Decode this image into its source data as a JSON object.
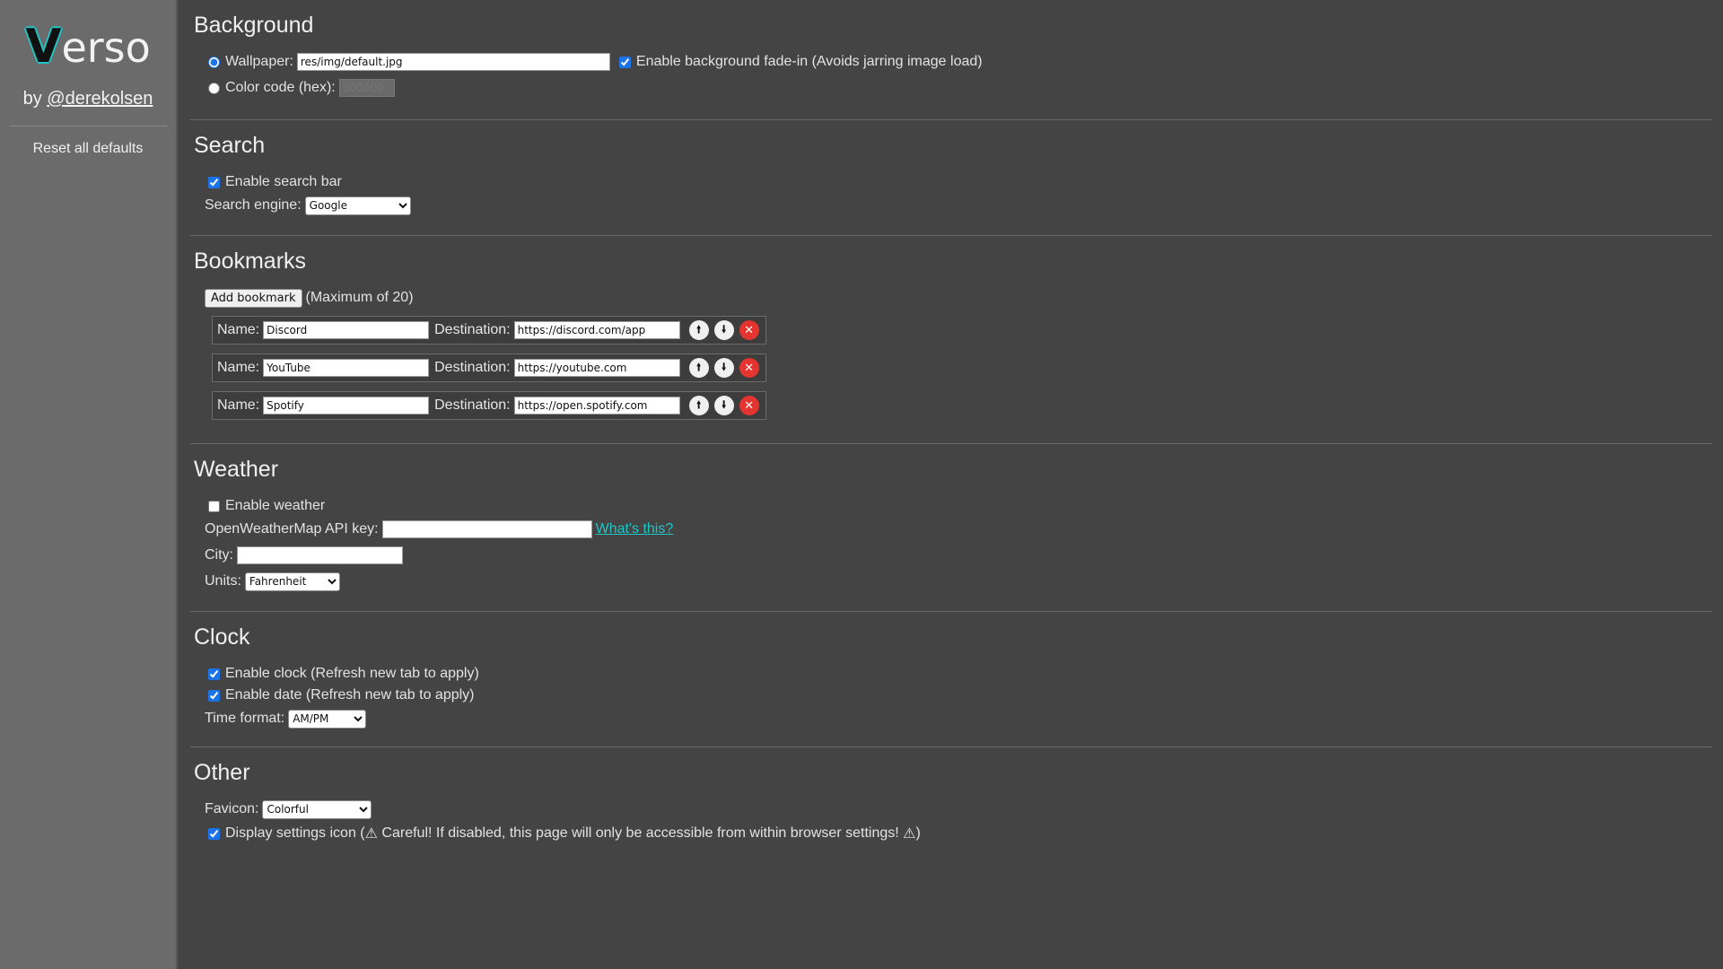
{
  "sidebar": {
    "logo_v": "V",
    "logo_rest": "erso",
    "by_prefix": "by ",
    "author_link": "@derekolsen",
    "reset_label": "Reset all defaults"
  },
  "background": {
    "title": "Background",
    "wallpaper_label": "Wallpaper:",
    "wallpaper_value": "res/img/default.jpg",
    "fadein_label": "Enable background fade-in (Avoids jarring image load)",
    "color_label": "Color code (hex):",
    "color_placeholder": "000000"
  },
  "search": {
    "title": "Search",
    "enable_label": "Enable search bar",
    "engine_label": "Search engine:",
    "engine_value": "Google"
  },
  "bookmarks": {
    "title": "Bookmarks",
    "add_label": "Add bookmark",
    "max_label": "(Maximum of 20)",
    "name_label": "Name:",
    "dest_label": "Destination:",
    "items": [
      {
        "name": "Discord",
        "dest": "https://discord.com/app"
      },
      {
        "name": "YouTube",
        "dest": "https://youtube.com"
      },
      {
        "name": "Spotify",
        "dest": "https://open.spotify.com"
      }
    ]
  },
  "weather": {
    "title": "Weather",
    "enable_label": "Enable weather",
    "api_label": "OpenWeatherMap API key:",
    "api_value": "",
    "whats_this": "What's this?",
    "city_label": "City:",
    "city_value": "",
    "units_label": "Units:",
    "units_value": "Fahrenheit"
  },
  "clock": {
    "title": "Clock",
    "clock_label": "Enable clock (Refresh new tab to apply)",
    "date_label": "Enable date (Refresh new tab to apply)",
    "format_label": "Time format:",
    "format_value": "AM/PM"
  },
  "other": {
    "title": "Other",
    "favicon_label": "Favicon:",
    "favicon_value": "Colorful",
    "settings_icon_pre": "Display settings icon (",
    "settings_icon_mid": " Careful! If disabled, this page will only be accessible from within browser settings! ",
    "settings_icon_post": ")"
  }
}
